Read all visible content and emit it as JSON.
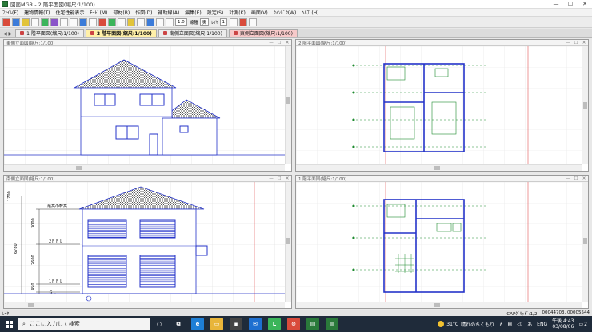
{
  "window": {
    "title": "図面MGR - 2 階平面図(縮尺:1/100)",
    "controls": [
      "—",
      "☐",
      "✕"
    ]
  },
  "menu": [
    "ﾌｧｲﾙ(F)",
    "建物情報(T)",
    "住宅性能表示",
    "ﾓｰﾄﾞ(M)",
    "部材(B)",
    "作図(D)",
    "補助線(A)",
    "編集(E)",
    "設定(S)",
    "計測(K)",
    "画面(V)",
    "ｳｨﾝﾄﾞｳ(W)",
    "ﾍﾙﾌﾟ(H)"
  ],
  "toolbar": {
    "scale_value": "1.0",
    "line_label": "線種",
    "line_value": "実",
    "layer_label": "ﾚｲﾔ",
    "layer_value": "1"
  },
  "tabs": [
    {
      "label": "1 階平面図(縮尺:1/100)",
      "state": "normal"
    },
    {
      "label": "2 階平面図(縮尺:1/100)",
      "state": "active"
    },
    {
      "label": "南側立面図(縮尺:1/100)",
      "state": "normal"
    },
    {
      "label": "東側立面図(縮尺:1/100)",
      "state": "pink"
    }
  ],
  "panes": {
    "top_left": "東側立面図(縮尺:1/100)",
    "top_right": "2 階平面図(縮尺:1/100)",
    "bottom_left": "南側立面図(縮尺:1/100)",
    "bottom_right": "1 階平面図(縮尺:1/100)"
  },
  "elevation_labels": {
    "dims": [
      "1700",
      "3000",
      "2600",
      "450"
    ],
    "total": "6780",
    "levels": [
      "最高の軒高",
      "2ＦＦＬ",
      "1ＦＦＬ",
      "ＧＬ"
    ]
  },
  "status": {
    "left": "ﾚｲﾔ",
    "mode": "CAPｸﾞﾘｯﾄﾞ:1/2",
    "coords": "00044703, 00005544"
  },
  "taskbar": {
    "search_placeholder": "ここに入力して検索",
    "weather_temp": "31°C",
    "weather_text": "晴れのちくもり",
    "ime": "あ",
    "lang": "ENG",
    "time": "午後 4:43",
    "date": "03/08/06",
    "notif_count": "2"
  },
  "colors": {
    "drawing_blue": "#2433c9",
    "drawing_green": "#1d8a2e",
    "grid_red": "#e05656",
    "taskbar": "#1f2b3a"
  }
}
